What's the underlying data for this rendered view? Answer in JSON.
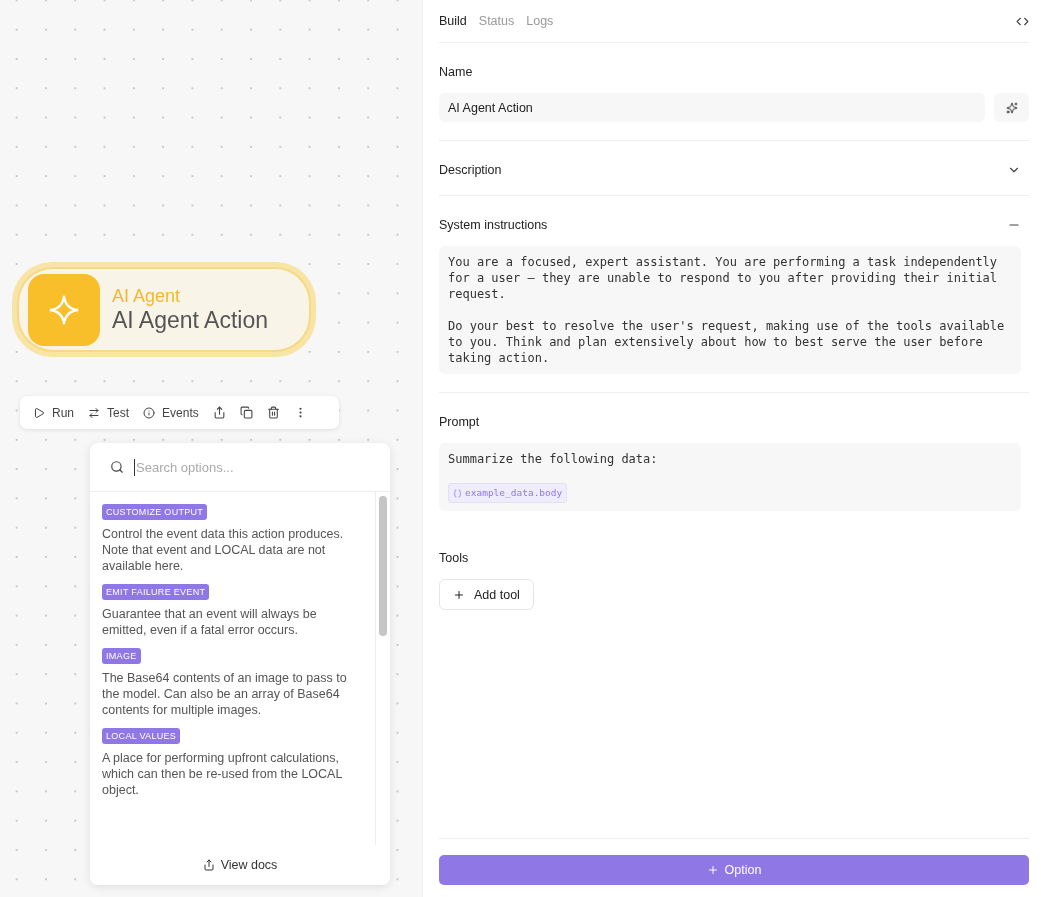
{
  "canvas": {
    "node": {
      "category": "AI Agent",
      "title": "AI Agent Action",
      "selected": true
    },
    "toolbar": [
      {
        "kind": "run",
        "label": "Run"
      },
      {
        "kind": "test",
        "label": "Test"
      },
      {
        "kind": "events",
        "label": "Events"
      }
    ],
    "options_menu": {
      "search": {
        "placeholder": "Search options..."
      },
      "options": [
        {
          "tag": "CUSTOMIZE OUTPUT",
          "description": "Control the event data this action produces. Note that event and LOCAL data are not available here."
        },
        {
          "tag": "EMIT FAILURE EVENT",
          "description": "Guarantee that an event will always be emitted, even if a fatal error occurs."
        },
        {
          "tag": "IMAGE",
          "description": "The Base64 contents of an image to pass to the model. Can also be an array of Base64 contents for multiple images."
        },
        {
          "tag": "LOCAL VALUES",
          "description": "A place for performing upfront calculations, which can then be re-used from the LOCAL object."
        }
      ],
      "footer": "View docs"
    }
  },
  "panel": {
    "tabs": [
      {
        "label": "Build",
        "selected": true
      },
      {
        "label": "Status",
        "selected": false
      },
      {
        "label": "Logs",
        "selected": false
      }
    ],
    "name": {
      "label": "Name",
      "value": "AI Agent Action"
    },
    "description": {
      "label": "Description",
      "expanded": false
    },
    "system_instructions": {
      "label": "System instructions",
      "expanded": true,
      "paragraphs": [
        "You are a focused, expert assistant. You are performing a task independently for a user – they are unable to respond to you after providing their initial request.",
        "Do your best to resolve the user's request, making use of the tools available to you. Think and plan extensively about how to best serve the user before taking action."
      ]
    },
    "prompt": {
      "label": "Prompt",
      "text": "Summarize the following data:",
      "variable": "example_data.body"
    },
    "tools": {
      "label": "Tools",
      "button": "Add tool"
    },
    "primary_button": "Option"
  }
}
